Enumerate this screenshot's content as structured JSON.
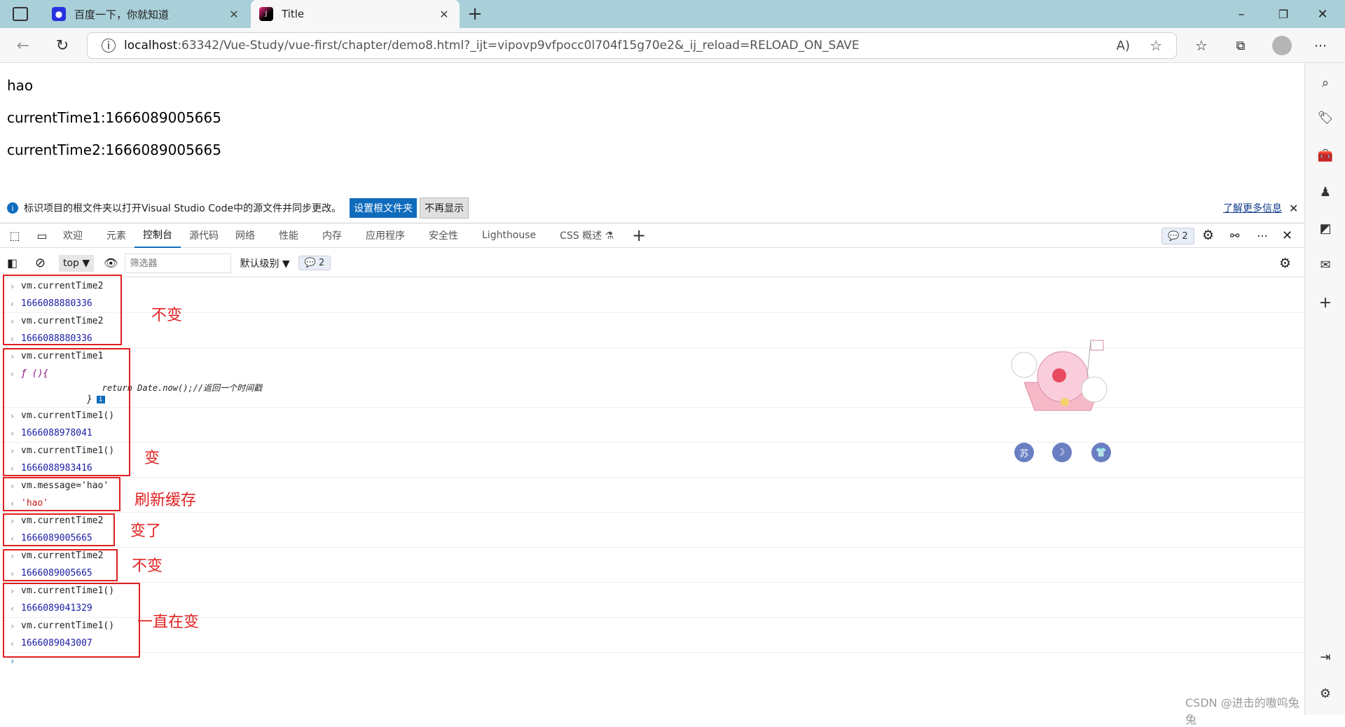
{
  "tabs": [
    {
      "label": "百度一下，你就知道",
      "favicon": "baidu-paw-icon"
    },
    {
      "label": "Title",
      "favicon": "jetbrains-icon"
    }
  ],
  "address": {
    "host": "localhost",
    "path": ":63342/Vue-Study/vue-first/chapter/demo8.html?_ijt=vipovp9vfpocc0l704f15g70e2&_ij_reload=RELOAD_ON_SAVE"
  },
  "page": {
    "message": "hao",
    "time1": "currentTime1:1666089005665",
    "time2": "currentTime2:1666089005665"
  },
  "infobar": {
    "text": "标识项目的根文件夹以打开Visual Studio Code中的源文件并同步更改。",
    "primary_button": "设置根文件夹",
    "secondary_button": "不再显示",
    "learn_more": "了解更多信息"
  },
  "devtools": {
    "tabs": [
      "欢迎",
      "元素",
      "控制台",
      "源代码",
      "网络",
      "性能",
      "内存",
      "应用程序",
      "安全性",
      "Lighthouse",
      "CSS 概述 ⚗"
    ],
    "selected_tab": "控制台",
    "issues_count": "2",
    "context": "top",
    "filter_placeholder": "筛选器",
    "level": "默认级别",
    "message_count": "2"
  },
  "console": [
    {
      "type": "in",
      "text": "vm.currentTime2"
    },
    {
      "type": "out",
      "text": "1666088880336"
    },
    {
      "type": "in",
      "text": "vm.currentTime2"
    },
    {
      "type": "out",
      "text": "1666088880336"
    },
    {
      "type": "in",
      "text": "vm.currentTime1"
    },
    {
      "type": "fn",
      "text": "ƒ (){"
    },
    {
      "type": "fnbody",
      "text": "                return Date.now();//返回一个时间戳"
    },
    {
      "type": "fnend",
      "text": "            }"
    },
    {
      "type": "in",
      "text": "vm.currentTime1()"
    },
    {
      "type": "out",
      "text": "1666088978041"
    },
    {
      "type": "in",
      "text": "vm.currentTime1()"
    },
    {
      "type": "out",
      "text": "1666088983416"
    },
    {
      "type": "in",
      "text": "vm.message='hao'"
    },
    {
      "type": "str",
      "text": "'hao'"
    },
    {
      "type": "in",
      "text": "vm.currentTime2"
    },
    {
      "type": "out",
      "text": "1666089005665"
    },
    {
      "type": "in",
      "text": "vm.currentTime2"
    },
    {
      "type": "out",
      "text": "1666089005665"
    },
    {
      "type": "in",
      "text": "vm.currentTime1()"
    },
    {
      "type": "out",
      "text": "1666089041329"
    },
    {
      "type": "in",
      "text": "vm.currentTime1()"
    },
    {
      "type": "out",
      "text": "1666089043007"
    }
  ],
  "annotations": [
    "不变",
    "变",
    "刷新缓存",
    "变了",
    "不变",
    "一直在变"
  ],
  "mascot_buttons": [
    "苏",
    "☽",
    "👕"
  ],
  "watermark": "CSDN @进击的嗷呜兔兔",
  "colors": {
    "tabbar": "#a9cfd8",
    "accent": "#0f6cbd",
    "annotation": "#e02020"
  }
}
